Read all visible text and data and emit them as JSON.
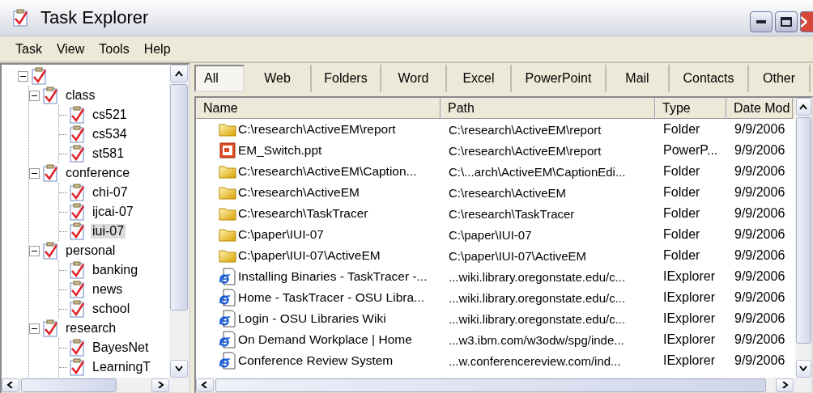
{
  "window": {
    "title": "Task Explorer"
  },
  "menu": [
    "Task",
    "View",
    "Tools",
    "Help"
  ],
  "tree": {
    "expanded": true,
    "children": [
      {
        "label": "class",
        "expanded": true,
        "selected": false,
        "children": [
          {
            "label": "cs521",
            "selected": false
          },
          {
            "label": "cs534",
            "selected": false
          },
          {
            "label": "st581",
            "selected": false
          }
        ]
      },
      {
        "label": "conference",
        "expanded": true,
        "selected": false,
        "children": [
          {
            "label": "chi-07",
            "selected": false
          },
          {
            "label": "ijcai-07",
            "selected": false
          },
          {
            "label": "iui-07",
            "selected": true
          }
        ]
      },
      {
        "label": "personal",
        "expanded": true,
        "selected": false,
        "children": [
          {
            "label": "banking",
            "selected": false
          },
          {
            "label": "news",
            "selected": false
          },
          {
            "label": "school",
            "selected": false
          }
        ]
      },
      {
        "label": "research",
        "expanded": true,
        "selected": false,
        "children": [
          {
            "label": "BayesNet",
            "selected": false
          },
          {
            "label": "LearningT",
            "selected": false
          }
        ]
      }
    ]
  },
  "tabs": [
    {
      "label": "All",
      "selected": true
    },
    {
      "label": "Web",
      "selected": false
    },
    {
      "label": "Folders",
      "selected": false
    },
    {
      "label": "Word",
      "selected": false
    },
    {
      "label": "Excel",
      "selected": false
    },
    {
      "label": "PowerPoint",
      "selected": false
    },
    {
      "label": "Mail",
      "selected": false
    },
    {
      "label": "Contacts",
      "selected": false
    },
    {
      "label": "Other",
      "selected": false
    }
  ],
  "table": {
    "columns": [
      "Name",
      "Path",
      "Type",
      "Date Mod"
    ],
    "rows": [
      {
        "kind": "folder",
        "cells": [
          "C:\\research\\ActiveEM\\report",
          "C:\\research\\ActiveEM\\report",
          "Folder",
          "9/9/2006"
        ]
      },
      {
        "kind": "ppt",
        "cells": [
          "EM_Switch.ppt",
          "C:\\research\\ActiveEM\\report",
          "PowerP...",
          "9/9/2006"
        ]
      },
      {
        "kind": "folder",
        "cells": [
          "C:\\research\\ActiveEM\\Caption...",
          "C:\\...arch\\ActiveEM\\CaptionEdi...",
          "Folder",
          "9/9/2006"
        ]
      },
      {
        "kind": "folder",
        "cells": [
          "C:\\research\\ActiveEM",
          "C:\\research\\ActiveEM",
          "Folder",
          "9/9/2006"
        ]
      },
      {
        "kind": "folder",
        "cells": [
          "C:\\research\\TaskTracer",
          "C:\\research\\TaskTracer",
          "Folder",
          "9/9/2006"
        ]
      },
      {
        "kind": "folder",
        "cells": [
          "C:\\paper\\IUI-07",
          "C:\\paper\\IUI-07",
          "Folder",
          "9/9/2006"
        ]
      },
      {
        "kind": "folder",
        "cells": [
          "C:\\paper\\IUI-07\\ActiveEM",
          "C:\\paper\\IUI-07\\ActiveEM",
          "Folder",
          "9/9/2006"
        ]
      },
      {
        "kind": "web",
        "cells": [
          "Installing Binaries - TaskTracer -...",
          "...wiki.library.oregonstate.edu/c...",
          "IExplorer",
          "9/9/2006"
        ]
      },
      {
        "kind": "web",
        "cells": [
          "Home - TaskTracer - OSU Libra...",
          "...wiki.library.oregonstate.edu/c...",
          "IExplorer",
          "9/9/2006"
        ]
      },
      {
        "kind": "web",
        "cells": [
          "Login - OSU Libraries Wiki",
          "...wiki.library.oregonstate.edu/c...",
          "IExplorer",
          "9/9/2006"
        ]
      },
      {
        "kind": "web",
        "cells": [
          "On Demand Workplace | Home",
          "...w3.ibm.com/w3odw/spg/inde...",
          "IExplorer",
          "9/9/2006"
        ]
      },
      {
        "kind": "web",
        "cells": [
          "Conference Review System",
          "...w.conferencereview.com/ind...",
          "IExplorer",
          "9/9/2006"
        ]
      }
    ]
  }
}
